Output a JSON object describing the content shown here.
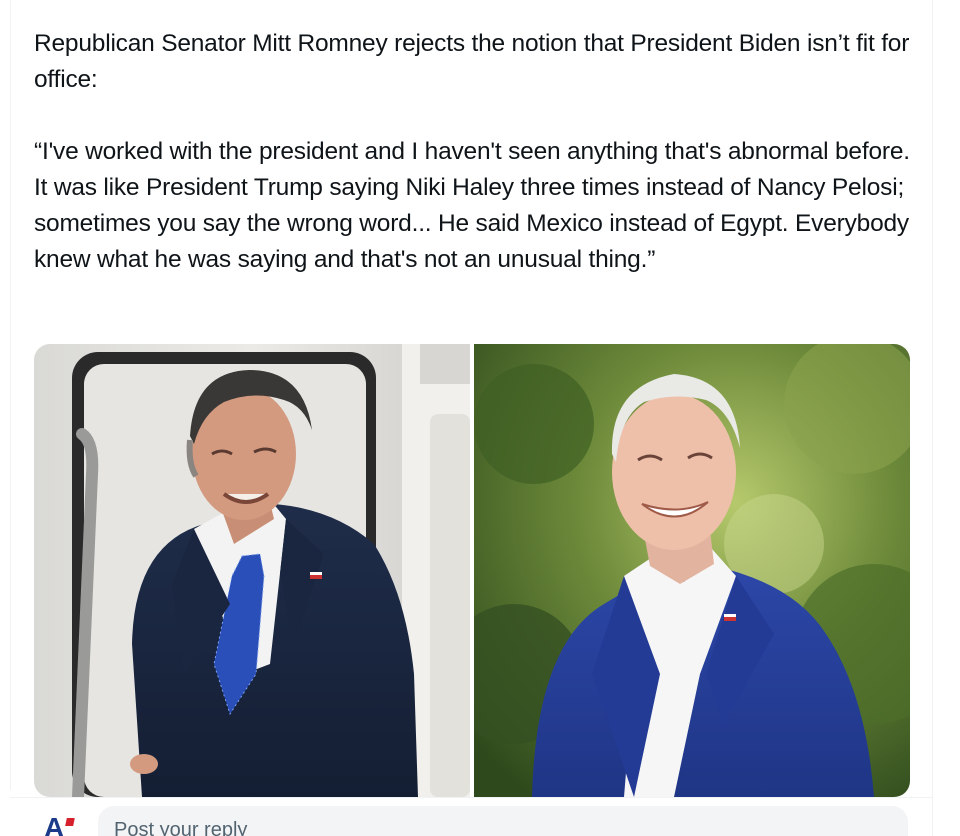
{
  "post": {
    "paragraph_1": "Republican Senator Mitt Romney rejects the notion that President Biden isn’t fit for office:",
    "paragraph_2": "“I've worked with the president and I haven't seen anything that's abnormal before. It was like President Trump saying Niki Haley three times instead of Nancy Pelosi; sometimes you say the wrong word... He said Mexico instead of Egypt. Everybody knew what he was saying and that's not an unusual thing.”"
  },
  "media": {
    "photos": [
      "photo-romney",
      "photo-biden"
    ]
  },
  "reply": {
    "avatar_letter": "A",
    "placeholder": "Post your reply"
  },
  "colors": {
    "text": "#0f1419",
    "muted": "#536471",
    "border": "#eff3f4",
    "input_bg": "#f3f4f6",
    "avatar_blue": "#1b3a8a",
    "avatar_red": "#d6202c"
  }
}
